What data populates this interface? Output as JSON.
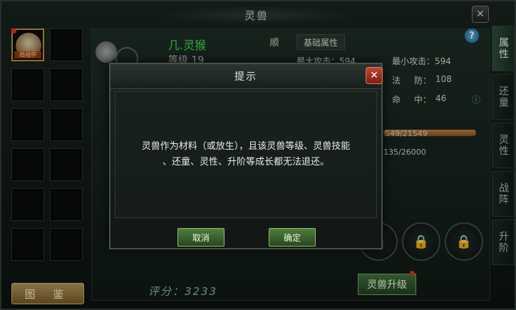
{
  "window": {
    "title": "灵兽",
    "close_icon": "close-icon"
  },
  "slots": {
    "active_tag": "出战中"
  },
  "atlas_button": "图 鉴",
  "beast": {
    "name": "几.灵猴",
    "level": "等级 19",
    "order": "顺",
    "basic_attr_tab": "基础属性"
  },
  "stats": {
    "max_attack": "最大攻击：594",
    "min_attack": "最小攻击：594",
    "magic_defense_label": "法",
    "magic_defense_label2": "防：",
    "magic_defense": "108",
    "hit_label": "命",
    "hit_label2": "中：",
    "hit": "46"
  },
  "exp": {
    "hp": "549/21549",
    "exp": "135/26000",
    "hp_fraction": 1.0
  },
  "score": "评分：3233",
  "upgrade_button": "灵兽升级",
  "tabs": [
    "属性",
    "还童",
    "灵性",
    "战阵",
    "升阶"
  ],
  "modal": {
    "title": "提示",
    "message_line1": "灵兽作为材料（或放生），且该灵兽等级、灵兽技能",
    "message_line2": "、还童、灵性、升阶等成长都无法退还。",
    "cancel": "取消",
    "confirm": "确定"
  },
  "colors": {
    "name_green": "#3bd24b",
    "button_green": "#4f7f3d",
    "close_red": "#c4452e",
    "active_border": "#b48a2a"
  }
}
